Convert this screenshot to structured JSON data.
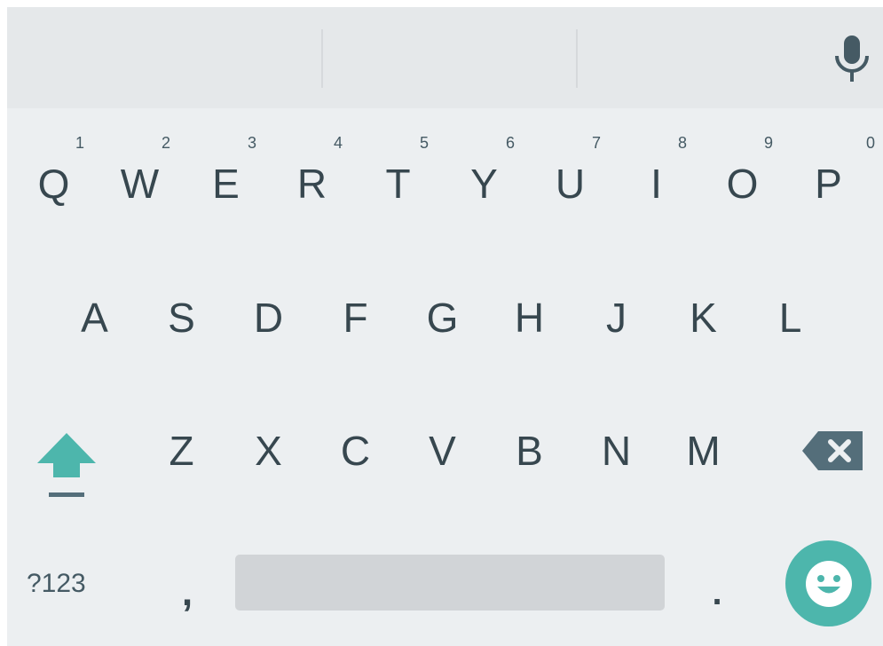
{
  "keyboard": {
    "suggestions": [
      "",
      "",
      ""
    ],
    "row1": [
      {
        "letter": "Q",
        "hint": "1"
      },
      {
        "letter": "W",
        "hint": "2"
      },
      {
        "letter": "E",
        "hint": "3"
      },
      {
        "letter": "R",
        "hint": "4"
      },
      {
        "letter": "T",
        "hint": "5"
      },
      {
        "letter": "Y",
        "hint": "6"
      },
      {
        "letter": "U",
        "hint": "7"
      },
      {
        "letter": "I",
        "hint": "8"
      },
      {
        "letter": "O",
        "hint": "9"
      },
      {
        "letter": "P",
        "hint": "0"
      }
    ],
    "row2": [
      "A",
      "S",
      "D",
      "F",
      "G",
      "H",
      "J",
      "K",
      "L"
    ],
    "row3": [
      "Z",
      "X",
      "C",
      "V",
      "B",
      "N",
      "M"
    ],
    "bottom": {
      "symbols_label": "?123",
      "comma": ",",
      "period": "."
    },
    "icons": {
      "mic": "microphone-icon",
      "shift": "shift-icon",
      "backspace": "backspace-icon",
      "emoji": "emoji-icon"
    },
    "colors": {
      "background": "#eceff1",
      "suggestion_strip": "#e5e8ea",
      "key_text": "#37474f",
      "accent": "#4db6ac"
    }
  }
}
